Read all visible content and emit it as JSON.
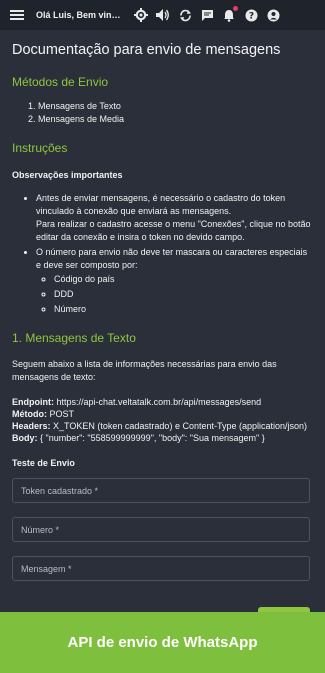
{
  "topbar": {
    "greeting": "Olá Luis, Bem vindo(a)",
    "icons": [
      "menu-icon",
      "settings-icon",
      "volume-icon",
      "refresh-icon",
      "chat-icon",
      "bell-icon",
      "help-icon",
      "account-icon"
    ],
    "notification_dot_color": "#e83b6a"
  },
  "page": {
    "title": "Documentação para envio de mensagens",
    "methods_heading": "Métodos de Envio",
    "methods": [
      "Mensagens de Texto",
      "Mensagens de Media"
    ],
    "instructions_heading": "Instruções",
    "observations_label": "Observações importantes",
    "obs1_line1": "Antes de enviar mensagens, é necessário o cadastro do token vinculado à conexão que enviará as mensagens.",
    "obs1_line2": "Para realizar o cadastro acesse o menu \"Conexões\", clique no botão editar da conexão e insira o token no devido campo.",
    "obs2": "O número para envio não deve ter mascara ou caracteres especiais e deve ser composto por:",
    "obs2_items": [
      "Código do país",
      "DDD",
      "Número"
    ],
    "text_section_heading": "1. Mensagens de Texto",
    "text_section_intro": "Seguem abaixo a lista de informações necessárias para envio das mensagens de texto:",
    "endpoint_label": "Endpoint:",
    "endpoint_value": "https://api-chat.veltatalk.com.br/api/messages/send",
    "method_label": "Método:",
    "method_value": "POST",
    "headers_label": "Headers:",
    "headers_value": "X_TOKEN (token cadastrado) e Content-Type (application/json)",
    "body_label": "Body:",
    "body_value": "{ \"number\": \"558599999999\", \"body\": \"Sua mensagem\" }",
    "test_label": "Teste de Envio"
  },
  "form": {
    "token_placeholder": "Token cadastrado *",
    "number_placeholder": "Número *",
    "message_placeholder": "Mensagem *"
  },
  "banner": {
    "text": "API de envio de WhatsApp",
    "color": "#7fbf3e"
  },
  "colors": {
    "accent": "#8ec641",
    "background": "#2a2f3a",
    "topbar": "#1f232b"
  }
}
